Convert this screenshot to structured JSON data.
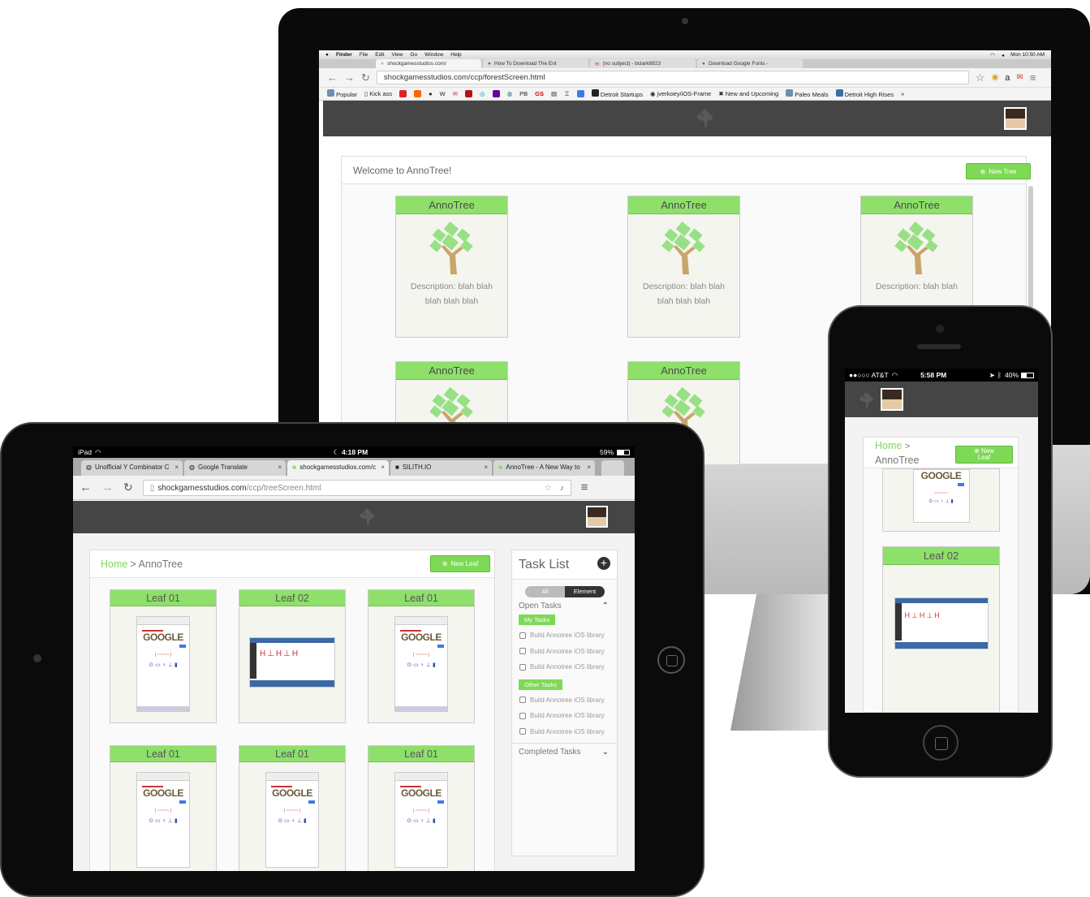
{
  "mac": {
    "menubar": {
      "items": [
        "Finder",
        "File",
        "Edit",
        "View",
        "Go",
        "Window",
        "Help"
      ],
      "clock": "Mon 10:50 AM"
    },
    "tabs": [
      "shockgamesstudios.com/",
      "How To Download The Ent",
      "(no subject) - bclark8923",
      "Download Google Fonts -"
    ],
    "url": "shockgamesstudios.com/ccp/forestScreen.html",
    "bookmarks": [
      "Popular",
      "Kick ass",
      "Detroit Startups",
      "jverkoey/iOS-Frame",
      "New and Upcoming",
      "Paleo Meals",
      "Detroit High Rises"
    ],
    "bookmark_letters": {
      "w": "W",
      "pb": "PB",
      "gs": "GS"
    },
    "ext_letter": "a",
    "more": "»",
    "welcome": "Welcome to AnnoTree!",
    "new_tree": "New Tree",
    "trees": [
      {
        "name": "AnnoTree",
        "desc": "Description: blah blah blah blah blah"
      },
      {
        "name": "AnnoTree",
        "desc": "Description: blah blah blah blah blah"
      },
      {
        "name": "AnnoTree",
        "desc": "Description: blah blah"
      },
      {
        "name": "AnnoTree",
        "desc": ""
      },
      {
        "name": "AnnoTree",
        "desc": ""
      }
    ]
  },
  "ipad": {
    "status": {
      "carrier": "iPad",
      "time": "4:18 PM",
      "battery": "59%"
    },
    "tabs": [
      "Unofficial Y Combinator C",
      "Google Translate",
      "shockgamesstudios.com/c",
      "SILITH.IO",
      "AnnoTree - A New Way to"
    ],
    "url_domain": "shockgamesstudios.com",
    "url_path": "/ccp/treeScreen.html",
    "breadcrumb_home": "Home",
    "breadcrumb_sep": ">",
    "breadcrumb_current": "AnnoTree",
    "new_leaf": "New Leaf",
    "leaves": [
      "Leaf 01",
      "Leaf 02",
      "Leaf 01",
      "Leaf 01",
      "Leaf 01",
      "Leaf 01"
    ],
    "google_word": "GOOGLE",
    "tasklist": {
      "title": "Task List",
      "seg_all": "All",
      "seg_element": "Element",
      "open_tasks": "Open Tasks",
      "my_tasks": "My Tasks",
      "my_items": [
        "Build Annotree iOS library",
        "Build Annotree iOS library",
        "Build Annotree iOS library"
      ],
      "other_tasks": "Other Tasks",
      "other_items": [
        "Build Annotree iOS library",
        "Build Annotree iOS library",
        "Build Annotree iOS library"
      ],
      "completed": "Completed Tasks"
    }
  },
  "iphone": {
    "status": {
      "carrier": "●●○○○ AT&T",
      "time": "5:58 PM",
      "battery": "40%"
    },
    "breadcrumb_home": "Home",
    "breadcrumb_sep": ">",
    "breadcrumb_current": "AnnoTree",
    "new_leaf_1": "New",
    "new_leaf_2": "Leaf",
    "google_word": "GOOGLE",
    "leaf": "Leaf 02"
  },
  "colors": {
    "accent_green": "#7ed957",
    "header_dark": "#454545"
  }
}
